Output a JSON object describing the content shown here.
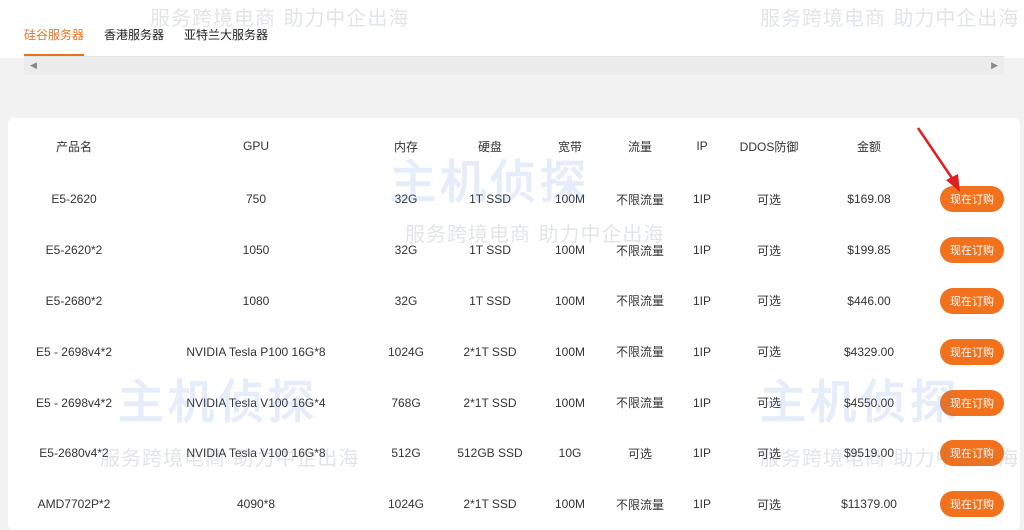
{
  "tabs": [
    {
      "label": "硅谷服务器",
      "active": true
    },
    {
      "label": "香港服务器",
      "active": false
    },
    {
      "label": "亚特兰大服务器",
      "active": false
    }
  ],
  "table": {
    "headers": [
      "产品名",
      "GPU",
      "内存",
      "硬盘",
      "宽带",
      "流量",
      "IP",
      "DDOS防御",
      "金额"
    ],
    "rows": [
      {
        "name": "E5-2620",
        "gpu": "750",
        "memory": "32G",
        "disk": "1T SSD",
        "bandwidth": "100M",
        "traffic": "不限流量",
        "ip": "1IP",
        "ddos": "可选",
        "price": "$169.08",
        "action": "现在订购"
      },
      {
        "name": "E5-2620*2",
        "gpu": "1050",
        "memory": "32G",
        "disk": "1T SSD",
        "bandwidth": "100M",
        "traffic": "不限流量",
        "ip": "1IP",
        "ddos": "可选",
        "price": "$199.85",
        "action": "现在订购"
      },
      {
        "name": "E5-2680*2",
        "gpu": "1080",
        "memory": "32G",
        "disk": "1T SSD",
        "bandwidth": "100M",
        "traffic": "不限流量",
        "ip": "1IP",
        "ddos": "可选",
        "price": "$446.00",
        "action": "现在订购"
      },
      {
        "name": "E5 - 2698v4*2",
        "gpu": "NVIDIA Tesla P100 16G*8",
        "memory": "1024G",
        "disk": "2*1T SSD",
        "bandwidth": "100M",
        "traffic": "不限流量",
        "ip": "1IP",
        "ddos": "可选",
        "price": "$4329.00",
        "action": "现在订购"
      },
      {
        "name": "E5 - 2698v4*2",
        "gpu": "NVIDIA Tesla V100 16G*4",
        "memory": "768G",
        "disk": "2*1T SSD",
        "bandwidth": "100M",
        "traffic": "不限流量",
        "ip": "1IP",
        "ddos": "可选",
        "price": "$4550.00",
        "action": "现在订购"
      },
      {
        "name": "E5-2680v4*2",
        "gpu": "NVIDIA Tesla V100 16G*8",
        "memory": "512G",
        "disk": "512GB SSD",
        "bandwidth": "10G",
        "traffic": "可选",
        "ip": "1IP",
        "ddos": "可选",
        "price": "$9519.00",
        "action": "现在订购"
      },
      {
        "name": "AMD7702P*2",
        "gpu": "4090*8",
        "memory": "1024G",
        "disk": "2*1T SSD",
        "bandwidth": "100M",
        "traffic": "不限流量",
        "ip": "1IP",
        "ddos": "可选",
        "price": "$11379.00",
        "action": "现在订购"
      }
    ]
  },
  "watermark": {
    "slogan": "服务跨境电商 助力中企出海",
    "brand": "主机侦探"
  },
  "colors": {
    "accent": "#e8731f",
    "button": "#f2711c",
    "annotation_arrow": "#e02020"
  }
}
